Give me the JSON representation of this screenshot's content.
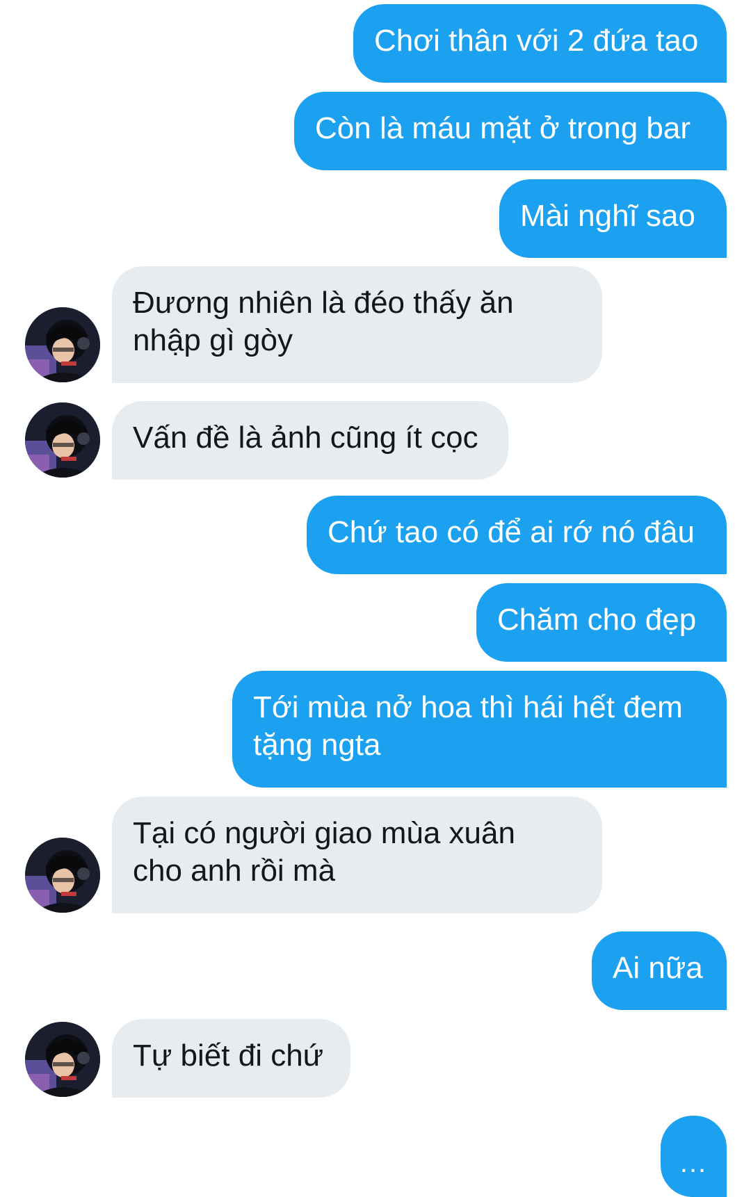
{
  "chat": {
    "messages": [
      {
        "direction": "outgoing",
        "text": "Chơi thân với 2 đứa tao"
      },
      {
        "direction": "outgoing",
        "text": "Còn là máu mặt ở trong bar"
      },
      {
        "direction": "outgoing",
        "text": "Mài nghĩ sao"
      },
      {
        "direction": "incoming",
        "text": "Đương nhiên là đéo thấy ăn\nnhập gì gòy"
      },
      {
        "direction": "incoming",
        "text": "Vấn đề là ảnh cũng ít cọc"
      },
      {
        "direction": "outgoing",
        "text": "Chứ tao có để ai rớ nó đâu"
      },
      {
        "direction": "outgoing",
        "text": "Chăm cho đẹp"
      },
      {
        "direction": "outgoing",
        "text": "Tới mùa nở hoa thì hái hết đem\ntặng ngta"
      },
      {
        "direction": "incoming",
        "text": "Tại có người giao mùa xuân\ncho anh rồi mà"
      },
      {
        "direction": "outgoing",
        "text": "Ai nữa"
      },
      {
        "direction": "incoming",
        "text": "Tự biết đi chứ"
      }
    ],
    "typing_indicator": "...",
    "colors": {
      "outgoing_bubble": "#1ca1f1",
      "outgoing_text": "#ffffff",
      "incoming_bubble": "#e6ecf0",
      "incoming_text": "#14171a",
      "background": "#ffffff"
    },
    "avatar_icon": "user-avatar-photo"
  }
}
